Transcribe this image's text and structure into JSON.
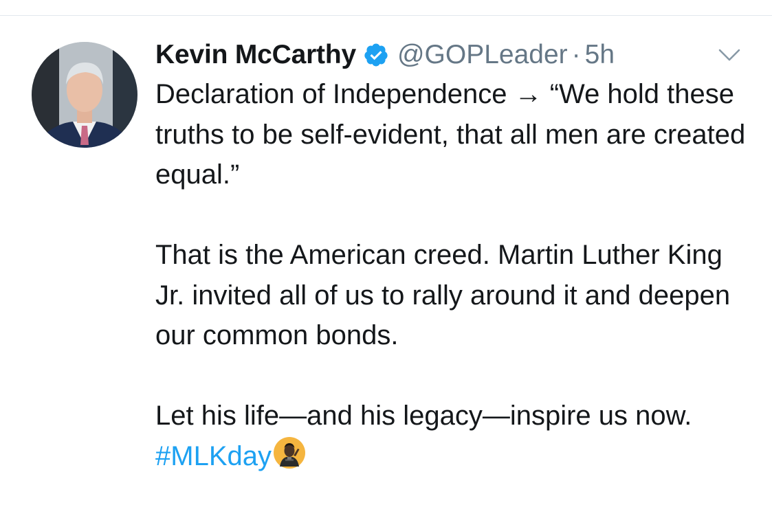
{
  "tweet": {
    "author": {
      "display_name": "Kevin McCarthy",
      "handle": "@GOPLeader",
      "verified": true,
      "avatar_icon": "profile-photo"
    },
    "separator": "·",
    "time_ago": "5h",
    "menu_icon": "chevron-down-icon",
    "paragraphs": [
      "Declaration of Independence → “We hold these truths to be self-evident, that all men are created equal.”",
      "That is the American creed. Martin Luther King Jr. invited all of us to rally around it and deepen our common bonds."
    ],
    "last_paragraph": {
      "text": "Let his life—and his legacy—inspire us now. ",
      "hashtag": "#MLKday",
      "hashtag_emoji": "mlk-speech-emoji"
    }
  },
  "colors": {
    "text": "#14171a",
    "secondary": "#657786",
    "link": "#1da1f2",
    "verified": "#1da1f2",
    "divider": "#e1e8ed"
  }
}
